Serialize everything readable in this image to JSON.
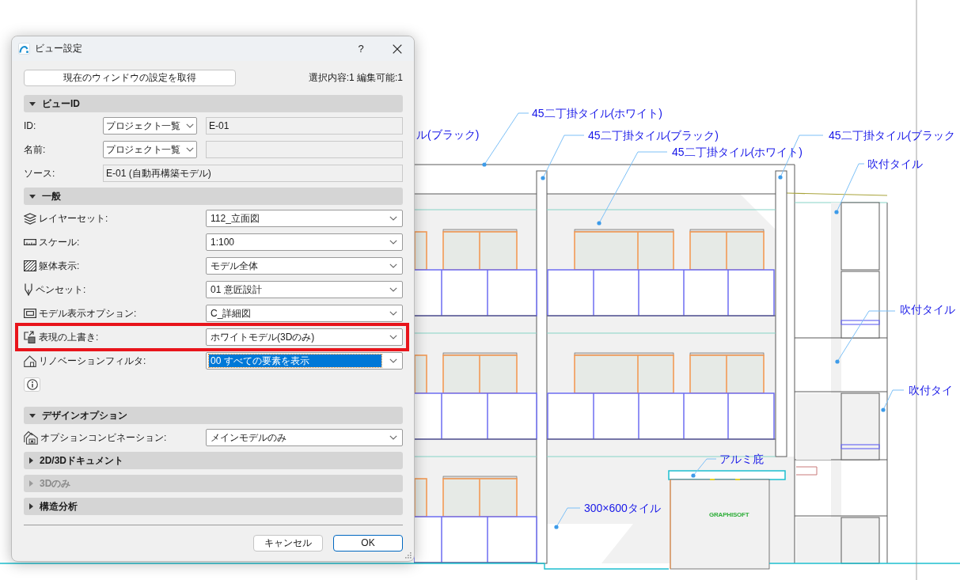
{
  "dialog": {
    "title": "ビュー設定",
    "help_button": "?",
    "get_settings_button": "現在のウィンドウの設定を取得",
    "selection_info": "選択内容:1 編集可能:1",
    "sections": [
      {
        "title": "ビューID",
        "expanded": true,
        "disabled": false,
        "rows": [
          {
            "kind": "select_text",
            "label": "ID:",
            "value": "プロジェクト一覧",
            "text": "E-01",
            "highlighted": false,
            "focused": false
          },
          {
            "kind": "select_text",
            "label": "名前:",
            "value": "プロジェクト一覧",
            "highlighted": false,
            "focused": false
          },
          {
            "kind": "text",
            "label": "ソース:",
            "text": "E-01 (自動再構築モデル)",
            "highlighted": false,
            "focused": false
          }
        ]
      },
      {
        "title": "一般",
        "expanded": true,
        "disabled": false,
        "rows": [
          {
            "kind": "select",
            "label": "レイヤーセット:",
            "value": "112_立面図",
            "highlighted": false,
            "focused": false
          },
          {
            "kind": "select",
            "label": "スケール:",
            "value": "1:100",
            "highlighted": false,
            "focused": false
          },
          {
            "kind": "select",
            "label": "躯体表示:",
            "value": "モデル全体",
            "highlighted": false,
            "focused": false
          },
          {
            "kind": "select",
            "label": "ペンセット:",
            "value": "01 意匠設計",
            "highlighted": false,
            "focused": false
          },
          {
            "kind": "select",
            "label": "モデル表示オプション:",
            "value": "C_詳細図",
            "highlighted": false,
            "focused": false
          },
          {
            "kind": "select",
            "label": "表現の上書き:",
            "value": "ホワイトモデル(3Dのみ)",
            "highlighted": true,
            "focused": false
          },
          {
            "kind": "select",
            "label": "リノベーションフィルタ:",
            "value": "00 すべての要素を表示",
            "highlighted": false,
            "focused": true
          },
          {
            "kind": "info",
            "highlighted": false,
            "focused": false
          }
        ]
      },
      {
        "title": "デザインオプション",
        "expanded": true,
        "disabled": false,
        "rows": [
          {
            "kind": "select",
            "label": "オプションコンビネーション:",
            "value": "メインモデルのみ",
            "highlighted": false,
            "focused": false
          }
        ]
      },
      {
        "title": "2D/3Dドキュメント",
        "expanded": false,
        "disabled": false
      },
      {
        "title": "3Dのみ",
        "expanded": false,
        "disabled": true
      },
      {
        "title": "構造分析",
        "expanded": false,
        "disabled": false
      }
    ],
    "buttons": [
      {
        "label": "キャンセル",
        "default": false
      },
      {
        "label": "OK",
        "default": true
      }
    ]
  },
  "drawing": {
    "annotations": [
      {
        "text": "45二丁掛タイル(ホワイト)"
      },
      {
        "text": "ル(ブラック)"
      },
      {
        "text": "45二丁掛タイル(ブラック)"
      },
      {
        "text": "45二丁掛タイル(ホワイト)"
      },
      {
        "text": "45二丁掛タイル(ブラック"
      },
      {
        "text": "吹付タイル"
      },
      {
        "text": "吹付タイル"
      },
      {
        "text": "吹付タイ"
      },
      {
        "text": "アルミ庇"
      },
      {
        "text": "300×600タイル"
      }
    ],
    "sign_text": "GRAPHISOFT"
  }
}
